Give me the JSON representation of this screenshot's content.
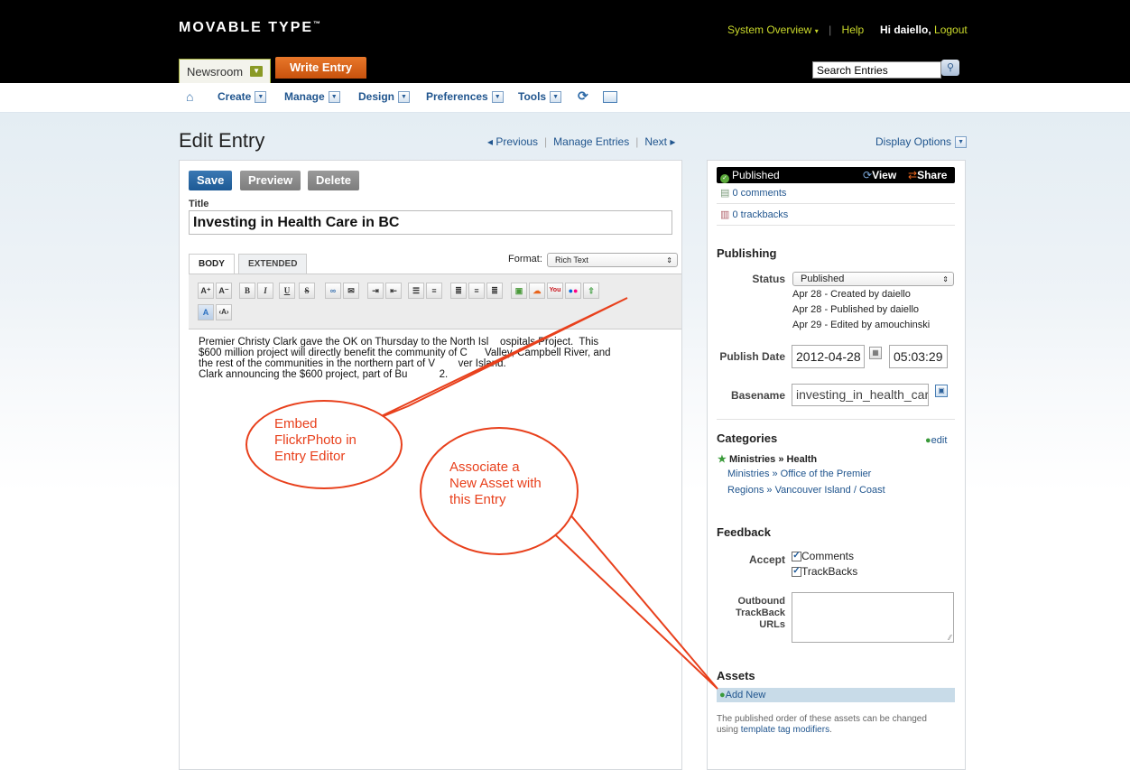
{
  "header": {
    "logo_text": "MOVABLE TYPE",
    "logo_tm": "™",
    "system_overview": "System Overview",
    "help": "Help",
    "greeting": "Hi daiello,",
    "logout": "Logout",
    "blog_name": "Newsroom",
    "write_entry": "Write Entry",
    "search_value": "Search Entries"
  },
  "nav": {
    "items": [
      "Create",
      "Manage",
      "Design",
      "Preferences",
      "Tools"
    ]
  },
  "page": {
    "title": "Edit Entry",
    "prev": "◂ Previous",
    "manage_entries": "Manage Entries",
    "next": "Next ▸",
    "display_options": "Display Options"
  },
  "editor": {
    "save": "Save",
    "preview": "Preview",
    "delete": "Delete",
    "title_label": "Title",
    "title_value": "Investing in Health Care in BC",
    "tab_body": "BODY",
    "tab_extended": "EXTENDED",
    "format_label": "Format:",
    "format_value": "Rich Text",
    "body_lines": [
      "Premier Christy Clark gave the OK on Thursday to the North Isl    ospitals Project.  This",
      "$600 million project will directly benefit the community of C      Valley, Campbell River, and",
      "the rest of the communities in the northern part of V        ver Island.",
      "Clark announcing the $600 project, part of Bu           2."
    ]
  },
  "callouts": {
    "flickr": [
      "Embed",
      "FlickrPhoto in",
      "Entry Editor"
    ],
    "asset": [
      "Associate a",
      "New Asset with",
      "this Entry"
    ]
  },
  "sidebar": {
    "status_badge": "Published",
    "view": "View",
    "share": "Share",
    "comments": "0 comments",
    "trackbacks": "0 trackbacks",
    "publishing_head": "Publishing",
    "status_label": "Status",
    "status_value": "Published",
    "history": [
      "Apr 28 - Created by daiello",
      "Apr 28 - Published by daiello",
      "Apr 29 - Edited by amouchinski"
    ],
    "publish_date_label": "Publish Date",
    "publish_date": "2012-04-28",
    "publish_time": "05:03:29",
    "basename_label": "Basename",
    "basename_value": "investing_in_health_care",
    "categories_head": "Categories",
    "categories_edit": "edit",
    "cat_primary": "Ministries » Health",
    "cat_others": [
      "Ministries » Office of the Premier",
      "Regions » Vancouver Island / Coast"
    ],
    "feedback_head": "Feedback",
    "accept_label": "Accept",
    "accept_comments": "Comments",
    "accept_trackbacks": "TrackBacks",
    "outbound_label_1": "Outbound",
    "outbound_label_2": "TrackBack",
    "outbound_label_3": "URLs",
    "assets_head": "Assets",
    "add_new": "Add New",
    "assets_note_1": "The published order of these assets can be changed",
    "assets_note_2": "using",
    "assets_note_link": "template tag modifiers",
    "assets_note_end": "."
  },
  "colors": {
    "accent_blue": "#20558e",
    "write_entry_orange": "#d9621a",
    "callout_red": "#e8401c",
    "header_green": "#c9d82b"
  }
}
